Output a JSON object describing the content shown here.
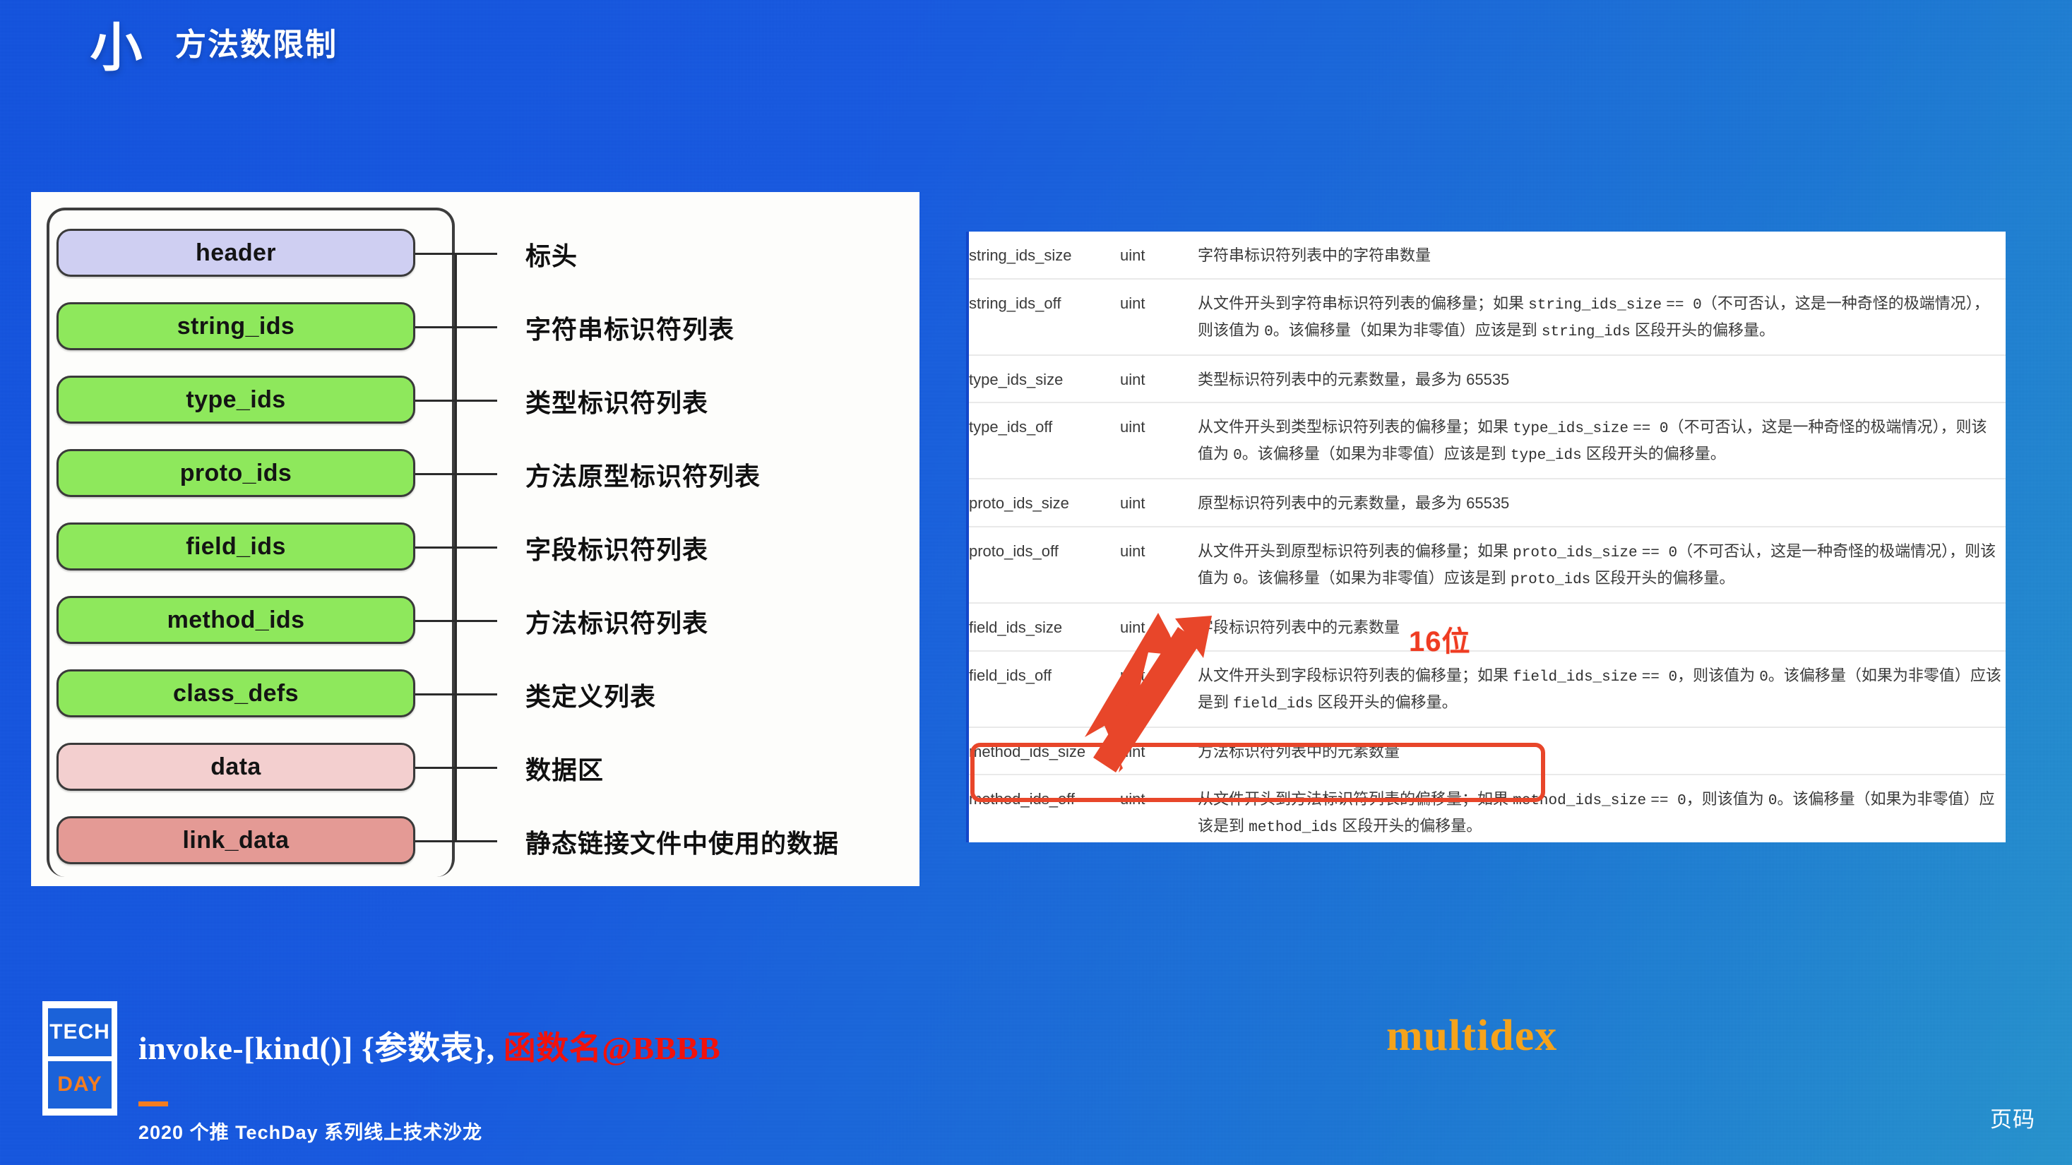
{
  "slide": {
    "title": "小",
    "subtitle": "方法数限制",
    "background_start": "#1152e0",
    "background_end": "#2493cf"
  },
  "dex_figure": {
    "sections": [
      {
        "name": "header",
        "label": "标头",
        "color": "#cfcff2",
        "swatch": "c-lavender"
      },
      {
        "name": "string_ids",
        "label": "字符串标识符列表",
        "color": "#8ee85c",
        "swatch": "c-green"
      },
      {
        "name": "type_ids",
        "label": "类型标识符列表",
        "color": "#8ee85c",
        "swatch": "c-green"
      },
      {
        "name": "proto_ids",
        "label": "方法原型标识符列表",
        "color": "#8ee85c",
        "swatch": "c-green"
      },
      {
        "name": "field_ids",
        "label": "字段标识符列表",
        "color": "#8ee85c",
        "swatch": "c-green"
      },
      {
        "name": "method_ids",
        "label": "方法标识符列表",
        "color": "#8ee85c",
        "swatch": "c-green"
      },
      {
        "name": "class_defs",
        "label": "类定义列表",
        "color": "#8ee85c",
        "swatch": "c-green"
      },
      {
        "name": "data",
        "label": "数据区",
        "color": "#f3cfcf",
        "swatch": "c-pink"
      },
      {
        "name": "link_data",
        "label": "静态链接文件中使用的数据",
        "color": "#e49a95",
        "swatch": "c-rose"
      }
    ]
  },
  "spec_table": {
    "rows": [
      {
        "name": "string_ids_size",
        "type": "uint",
        "desc": "字符串标识符列表中的字符串数量"
      },
      {
        "name": "string_ids_off",
        "type": "uint",
        "desc": "从文件开头到字符串标识符列表的偏移量；如果 string_ids_size == 0（不可否认，这是一种奇怪的极端情况），则该值为 0。该偏移量（如果为非零值）应该是到 string_ids 区段开头的偏移量。"
      },
      {
        "name": "type_ids_size",
        "type": "uint",
        "desc": "类型标识符列表中的元素数量，最多为 65535"
      },
      {
        "name": "type_ids_off",
        "type": "uint",
        "desc": "从文件开头到类型标识符列表的偏移量；如果 type_ids_size == 0（不可否认，这是一种奇怪的极端情况），则该值为 0。该偏移量（如果为非零值）应该是到 type_ids 区段开头的偏移量。"
      },
      {
        "name": "proto_ids_size",
        "type": "uint",
        "desc": "原型标识符列表中的元素数量，最多为 65535"
      },
      {
        "name": "proto_ids_off",
        "type": "uint",
        "desc": "从文件开头到原型标识符列表的偏移量；如果 proto_ids_size == 0（不可否认，这是一种奇怪的极端情况），则该值为 0。该偏移量（如果为非零值）应该是到 proto_ids 区段开头的偏移量。"
      },
      {
        "name": "field_ids_size",
        "type": "uint",
        "desc": "字段标识符列表中的元素数量"
      },
      {
        "name": "field_ids_off",
        "type": "uint",
        "desc": "从文件开头到字段标识符列表的偏移量；如果 field_ids_size == 0，则该值为 0。该偏移量（如果为非零值）应该是到 field_ids 区段开头的偏移量。"
      },
      {
        "name": "method_ids_size",
        "type": "uint",
        "desc": "方法标识符列表中的元素数量"
      },
      {
        "name": "method_ids_off",
        "type": "uint",
        "desc": "从文件开头到方法标识符列表的偏移量；如果 method_ids_size == 0，则该值为 0。该偏移量（如果为非零值）应该是到 method_ids 区段开头的偏移量。"
      }
    ]
  },
  "annotations": {
    "bit_note": "16位",
    "bit_note_color": "#ef3b21",
    "highlight_color": "#e8462a",
    "arrow_color": "#e8462a"
  },
  "footer": {
    "logo_line1": "TECH",
    "logo_line2": "DAY",
    "equation_plain": "invoke-[kind()] {参数表}, ",
    "equation_red": "函数名@BBBB",
    "subtitle": "2020 个推 TechDay 系列线上技术沙龙",
    "multidex": "multidex",
    "page_number": "页码",
    "accent_orange": "#f47d20",
    "accent_yellow": "#f5a31b",
    "accent_red": "#f2120c"
  }
}
